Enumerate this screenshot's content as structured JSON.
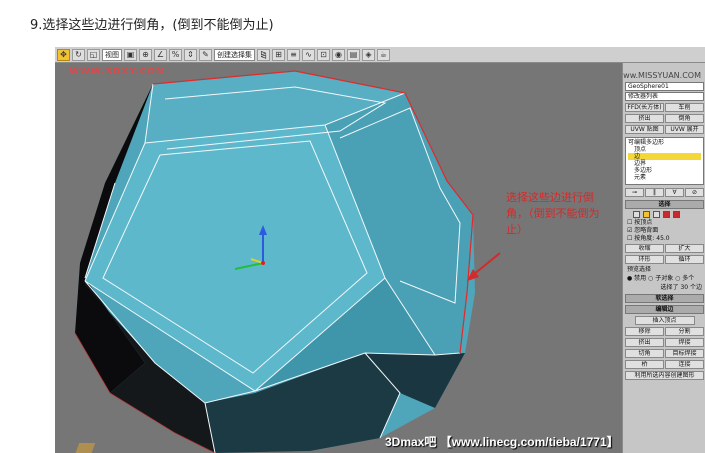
{
  "step": {
    "title": "9.选择这些边进行倒角，(倒到不能倒为止)"
  },
  "toolbar": {
    "view_select": "视图",
    "named_sel_select": "创建选择集",
    "buttons": [
      "move-icon",
      "rotate-icon",
      "scale-icon",
      "select-icon",
      "snap-icon",
      "angle-snap-icon",
      "mirror-icon",
      "align-icon",
      "layer-icon",
      "curve-icon",
      "schematic-icon",
      "material-icon",
      "render-setup-icon",
      "render-icon",
      "teapot-icon"
    ]
  },
  "viewport": {
    "watermark_top": "WWW.3DXY.COM",
    "annotation": "选择这些边进行倒角，（倒到不能倒为止）",
    "watermark_bottom": "3Dmax吧 【www.linecg.com/tieba/1771】",
    "colors": {
      "background": "#767676",
      "faces": "#5fb4c8",
      "dark_faces": "#0e0e10",
      "edges": "#f2f8fb",
      "selected_edges": "#e02a2a"
    }
  },
  "panel": {
    "site_watermark": "思缘设计论坛 www.MISSYUAN.COM",
    "object_name": "GeoSphere01",
    "modifier_list": "修改器列表",
    "btn_ffd": "FFD(长方体)",
    "btn_lathe": "车削",
    "btn_extrude": "挤出",
    "btn_bevel": "倒角",
    "btn_uvw_map": "UVW 贴图",
    "btn_uvw_unwrap": "UVW 展开",
    "stack": {
      "root": "可编辑多边形",
      "items": [
        "顶点",
        "边",
        "边界",
        "多边形",
        "元素"
      ],
      "selected_index": 1
    },
    "selection": {
      "header": "选择",
      "by_vertex": "按顶点",
      "ignore_backfacing": "忽略背面",
      "by_angle": "按角度:",
      "angle_value": "45.0",
      "shrink": "收缩",
      "grow": "扩大",
      "ring": "环形",
      "loop": "循环",
      "preview_selection": "预览选择",
      "preview_options": "● 禁用 ○ 子对象 ○ 多个",
      "status": "选择了 30 个边"
    },
    "soft_selection_header": "软选择",
    "edit_edges": {
      "header": "编辑边",
      "insert_vertex": "插入顶点",
      "remove": "移除",
      "split": "分割",
      "extrude": "挤出",
      "weld": "焊接",
      "chamfer": "切角",
      "target_weld": "目标焊接",
      "bridge": "桥",
      "connect": "连接",
      "create_shape": "利用所选内容创建图形"
    }
  }
}
